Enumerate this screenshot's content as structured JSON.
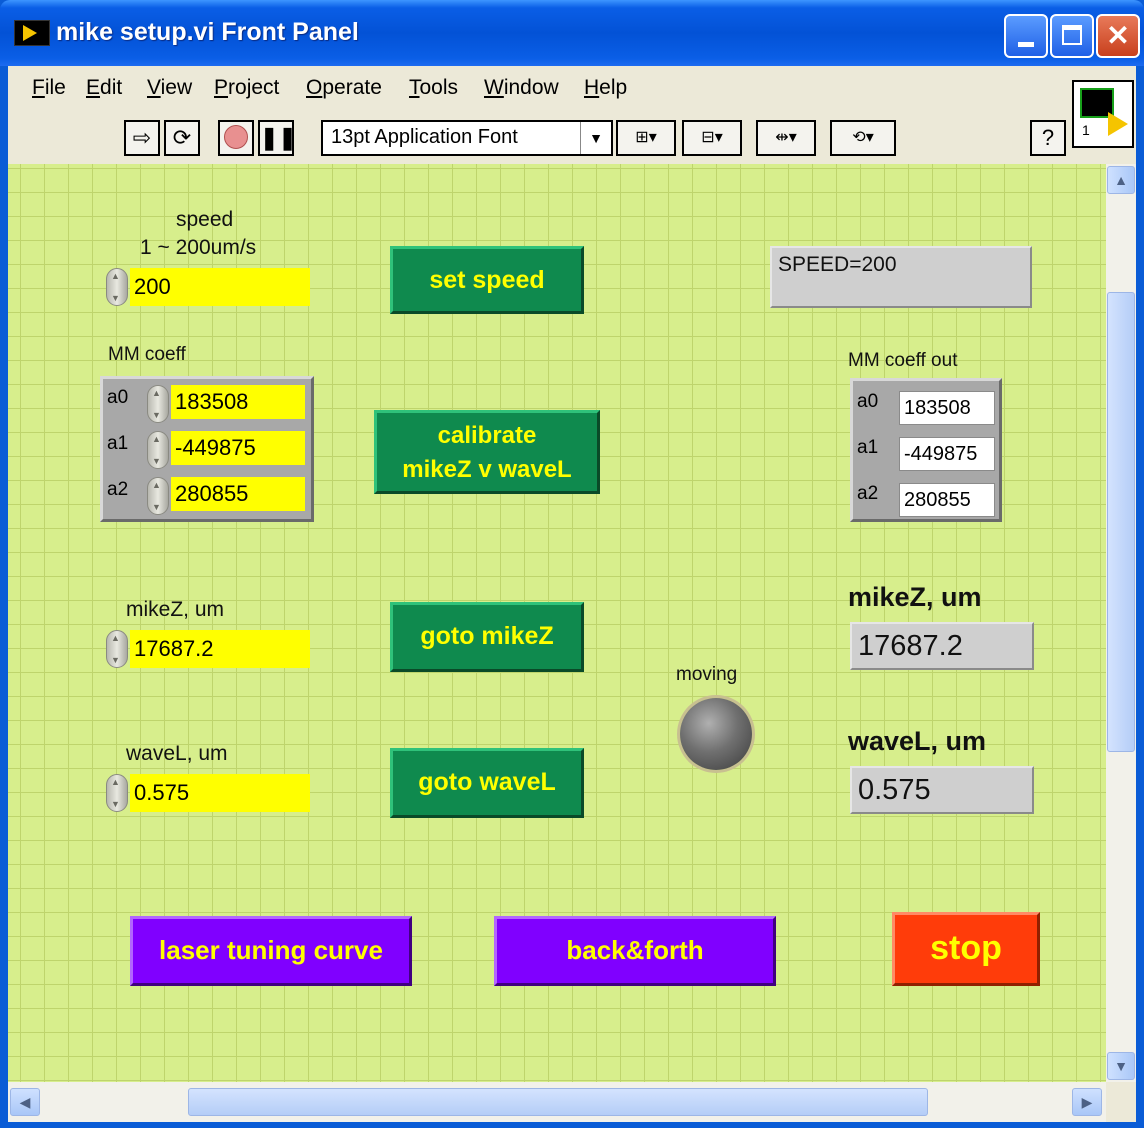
{
  "window": {
    "title": "mike setup.vi Front Panel"
  },
  "menu": [
    {
      "label": "File",
      "u": "F",
      "rest": "ile"
    },
    {
      "label": "Edit",
      "u": "E",
      "rest": "dit"
    },
    {
      "label": "View",
      "u": "V",
      "rest": "iew"
    },
    {
      "label": "Project",
      "u": "P",
      "rest": "roject"
    },
    {
      "label": "Operate",
      "u": "O",
      "rest": "perate"
    },
    {
      "label": "Tools",
      "u": "T",
      "rest": "ools"
    },
    {
      "label": "Window",
      "u": "W",
      "rest": "indow"
    },
    {
      "label": "Help",
      "u": "H",
      "rest": "elp"
    }
  ],
  "toolbar": {
    "font_select": "13pt Application Font",
    "help_glyph": "?",
    "vi_icon_number": "1"
  },
  "panel": {
    "speed": {
      "label_line1": "speed",
      "label_line2": "1 ~ 200um/s",
      "value": "200"
    },
    "set_speed_button": "set speed",
    "speed_readout": "SPEED=200",
    "mm_coeff": {
      "label": "MM coeff",
      "rows": [
        {
          "name": "a0",
          "value": "183508"
        },
        {
          "name": "a1",
          "value": "-449875"
        },
        {
          "name": "a2",
          "value": "280855"
        }
      ]
    },
    "calibrate_button": {
      "line1": "calibrate",
      "line2": "mikeZ v waveL"
    },
    "mm_coeff_out": {
      "label": "MM coeff out",
      "rows": [
        {
          "name": "a0",
          "value": "183508"
        },
        {
          "name": "a1",
          "value": "-449875"
        },
        {
          "name": "a2",
          "value": "280855"
        }
      ]
    },
    "mikez": {
      "label": "mikeZ, um",
      "value": "17687.2"
    },
    "goto_mikez_button": "goto mikeZ",
    "mikez_out": {
      "label": "mikeZ, um",
      "value": "17687.2"
    },
    "moving": {
      "label": "moving",
      "state": "off"
    },
    "wavel": {
      "label": "waveL, um",
      "value": "0.575"
    },
    "goto_wavel_button": "goto waveL",
    "wavel_out": {
      "label": "waveL, um",
      "value": "0.575"
    },
    "laser_tuning_button": "laser tuning curve",
    "back_forth_button": "back&forth",
    "stop_button": "stop"
  },
  "colors": {
    "panel_bg": "#d7ee8c",
    "control_bg": "#ffff00",
    "green_button": "#0f8a4e",
    "purple_button": "#8000ff",
    "stop_button": "#ff3c0a",
    "button_text": "#ffff00"
  }
}
